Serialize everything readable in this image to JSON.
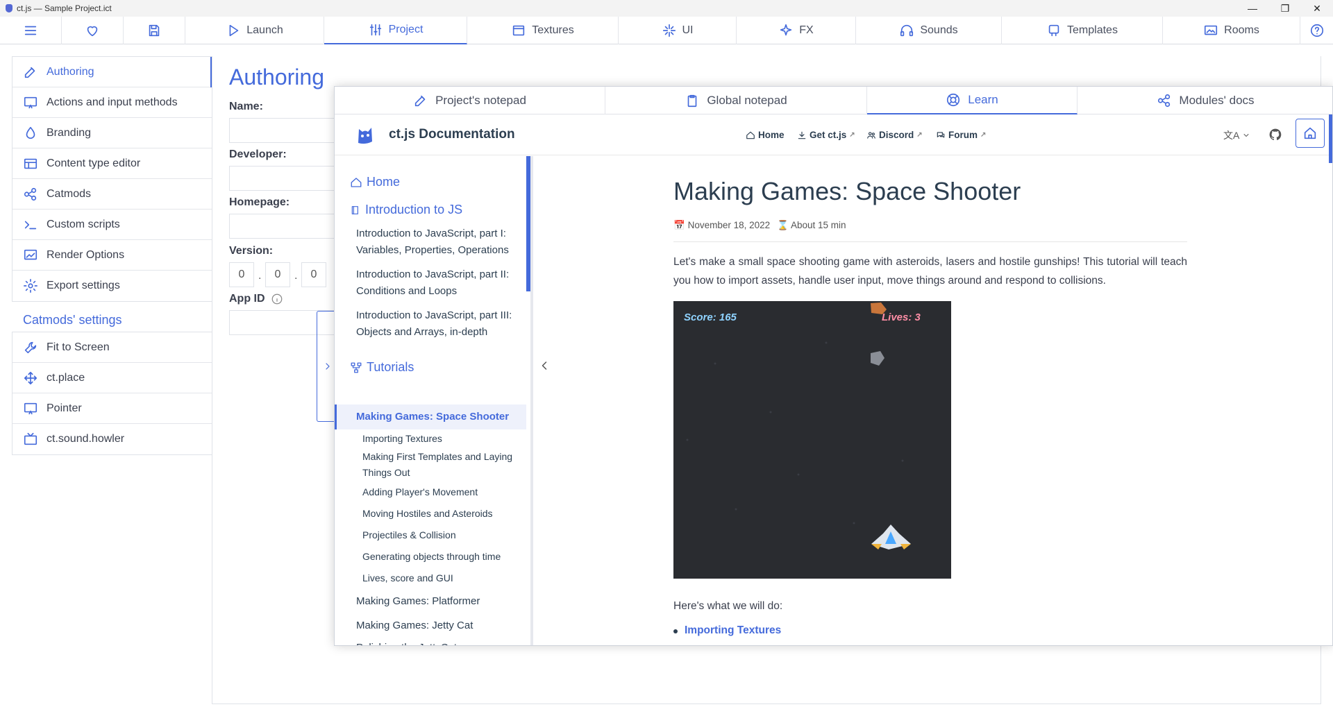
{
  "window": {
    "title": "ct.js — Sample Project.ict"
  },
  "topbar": {
    "tabs": [
      {
        "label": "Launch",
        "icon": "play-icon"
      },
      {
        "label": "Project",
        "icon": "sliders-icon",
        "active": true
      },
      {
        "label": "Textures",
        "icon": "texture-icon"
      },
      {
        "label": "UI",
        "icon": "sparkle-icon"
      },
      {
        "label": "FX",
        "icon": "fx-icon"
      },
      {
        "label": "Sounds",
        "icon": "headphones-icon"
      },
      {
        "label": "Templates",
        "icon": "template-icon"
      },
      {
        "label": "Rooms",
        "icon": "room-icon"
      }
    ]
  },
  "sidebar": {
    "items": [
      {
        "label": "Authoring"
      },
      {
        "label": "Actions and input methods"
      },
      {
        "label": "Branding"
      },
      {
        "label": "Content type editor"
      },
      {
        "label": "Catmods"
      },
      {
        "label": "Custom scripts"
      },
      {
        "label": "Render Options"
      },
      {
        "label": "Export settings"
      }
    ],
    "catmods_heading": "Catmods' settings",
    "catmods": [
      {
        "label": "Fit to Screen"
      },
      {
        "label": "ct.place"
      },
      {
        "label": "Pointer"
      },
      {
        "label": "ct.sound.howler"
      }
    ]
  },
  "main": {
    "title": "Authoring",
    "name_label": "Name:",
    "developer_label": "Developer:",
    "homepage_label": "Homepage:",
    "version_label": "Version:",
    "version": [
      "0",
      "0",
      "0"
    ],
    "appid_label": "App ID"
  },
  "docs": {
    "tabs": [
      {
        "label": "Project's notepad"
      },
      {
        "label": "Global notepad"
      },
      {
        "label": "Learn",
        "active": true
      },
      {
        "label": "Modules' docs"
      }
    ],
    "brand": "ct.js Documentation",
    "nav": {
      "home": "Home",
      "get": "Get ct.js",
      "discord": "Discord",
      "forum": "Forum"
    },
    "side": {
      "home": "Home",
      "intro_heading": "Introduction to JS",
      "intro_items": [
        "Introduction to JavaScript, part I: Variables, Properties, Operations",
        "Introduction to JavaScript, part II: Conditions and Loops",
        "Introduction to JavaScript, part III: Objects and Arrays, in-depth"
      ],
      "tutorials_heading": "Tutorials",
      "active_item": "Making Games: Space Shooter",
      "sub_items": [
        "Importing Textures",
        "Making First Templates and Laying Things Out",
        "Adding Player's Movement",
        "Moving Hostiles and Asteroids",
        "Projectiles & Collision",
        "Generating objects through time",
        "Lives, score and GUI"
      ],
      "more_items": [
        "Making Games: Platformer",
        "Making Games: Jetty Cat",
        "Polishing the JettyCat"
      ]
    },
    "article": {
      "title": "Making Games: Space Shooter",
      "date": "November 18, 2022",
      "read_time": "About 15 min",
      "lead": "Let's make a small space shooting game with asteroids, lasers and hostile gunships! This tutorial will teach you how to import assets, handle user input, move things around and respond to collisions.",
      "game": {
        "score": "Score: 165",
        "lives": "Lives: 3"
      },
      "after": "Here's what we will do:",
      "first_bullet": "Importing Textures"
    }
  },
  "colors": {
    "accent": "#446adb",
    "text": "#2c3e50",
    "game_bg": "#2a2c30"
  }
}
